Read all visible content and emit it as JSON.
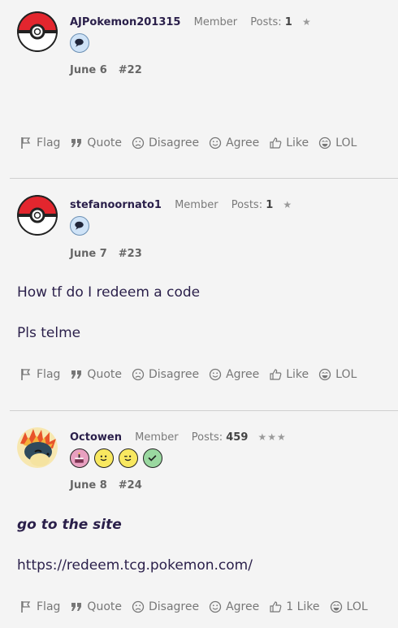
{
  "posts": [
    {
      "username": "AJPokemon201315",
      "rank": "Member",
      "posts_label": "Posts:",
      "posts_count": "1",
      "stars": "★",
      "date": "June 6",
      "number": "#22",
      "lines": []
    },
    {
      "username": "stefanoornato1",
      "rank": "Member",
      "posts_label": "Posts:",
      "posts_count": "1",
      "stars": "★",
      "date": "June 7",
      "number": "#23",
      "lines": [
        "How tf do I redeem a code",
        "Pls telme"
      ]
    },
    {
      "username": "Octowen",
      "rank": "Member",
      "posts_label": "Posts:",
      "posts_count": "459",
      "stars": "★★★",
      "date": "June 8",
      "number": "#24",
      "lines": [
        "go to the site",
        "https://redeem.tcg.pokemon.com/"
      ]
    }
  ],
  "actions": {
    "flag": "Flag",
    "quote": "Quote",
    "disagree": "Disagree",
    "agree": "Agree",
    "like": "Like",
    "like_1": "1 Like",
    "lol": "LOL"
  },
  "icons": {
    "avatar_pokeball": "pokeball-avatar",
    "avatar_octowen": "cyndaquil-avatar",
    "badge_chat": "speech-bubble-icon",
    "badge_cake": "cake-icon",
    "badge_smile": "smile-icon",
    "badge_wink": "wink-icon",
    "badge_check": "check-icon"
  },
  "colors": {
    "username": "#2a1f4a",
    "muted": "#777777",
    "divider": "#cfcfcf"
  }
}
